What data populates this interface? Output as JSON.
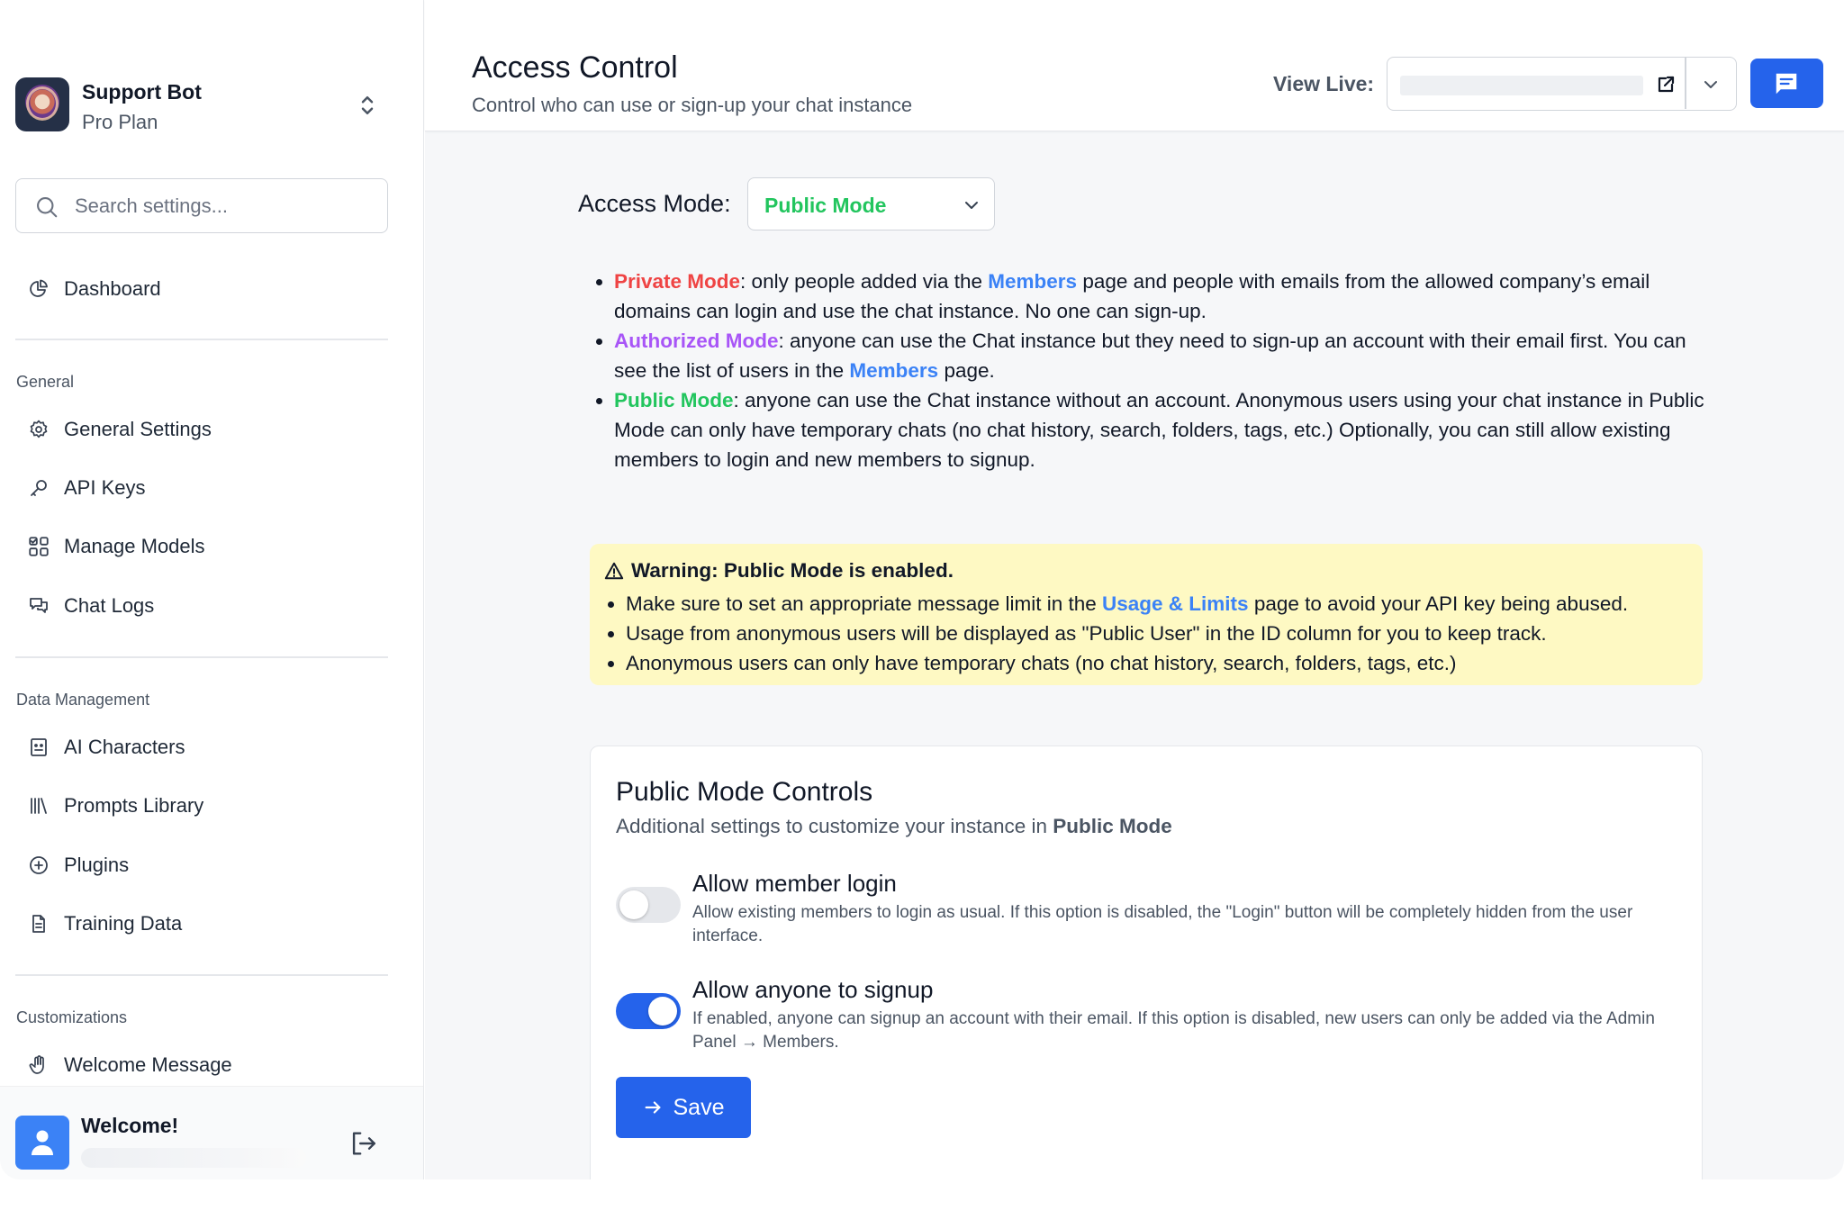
{
  "brand": {
    "name": "Support Bot",
    "plan": "Pro Plan"
  },
  "search": {
    "placeholder": "Search settings..."
  },
  "sidebar": {
    "dashboard": "Dashboard",
    "sections": [
      {
        "label": "General",
        "items": [
          "General Settings",
          "API Keys",
          "Manage Models",
          "Chat Logs"
        ]
      },
      {
        "label": "Data Management",
        "items": [
          "AI Characters",
          "Prompts Library",
          "Plugins",
          "Training Data"
        ]
      },
      {
        "label": "Customizations",
        "items": [
          "Welcome Message"
        ]
      }
    ]
  },
  "user": {
    "greeting": "Welcome!"
  },
  "header": {
    "title": "Access Control",
    "subtitle": "Control who can use or sign-up your chat instance",
    "view_live_label": "View Live:"
  },
  "access": {
    "label": "Access Mode:",
    "selected": "Public Mode",
    "modes": {
      "private": {
        "name": "Private Mode",
        "t1": ": only people added via the ",
        "link": "Members",
        "t2": " page and people with emails from the allowed company’s email domains can login and use the chat instance. No one can sign-up."
      },
      "authorized": {
        "name": "Authorized Mode",
        "t1": ": anyone can use the Chat instance but they need to sign-up an account with their email first. You can see the list of users in the ",
        "link": "Members",
        "t2": " page."
      },
      "public": {
        "name": "Public Mode",
        "t1": ": anyone can use the Chat instance without an account. Anonymous users using your chat instance in Public Mode can only have temporary chats (no chat history, search, folders, tags, etc.) Optionally, you can still allow existing members to login and new members to signup."
      }
    }
  },
  "warning": {
    "title": "Warning: Public Mode is enabled.",
    "b1_pre": "Make sure to set an appropriate message limit in the ",
    "b1_link": "Usage & Limits",
    "b1_post": " page to avoid your API key being abused.",
    "b2": "Usage from anonymous users will be displayed as \"Public User\" in the ID column for you to keep track.",
    "b3": "Anonymous users can only have temporary chats (no chat history, search, folders, tags, etc.)"
  },
  "controls": {
    "title": "Public Mode Controls",
    "subtitle_pre": "Additional settings to customize your instance in ",
    "subtitle_bold": "Public Mode",
    "options": [
      {
        "title": "Allow member login",
        "desc": "Allow existing members to login as usual. If this option is disabled, the \"Login\" button will be completely hidden from the user interface.",
        "enabled": false
      },
      {
        "title": "Allow anyone to signup",
        "desc": "If enabled, anyone can signup an account with their email. If this option is disabled, new users can only be added via the Admin Panel → Members.",
        "enabled": true
      }
    ],
    "save_label": "Save"
  },
  "colors": {
    "accent": "#2563eb",
    "private": "#ef4444",
    "authorized": "#a855f7",
    "public": "#22c55e",
    "link": "#3b82f6",
    "warning_bg": "#fef9c3"
  }
}
